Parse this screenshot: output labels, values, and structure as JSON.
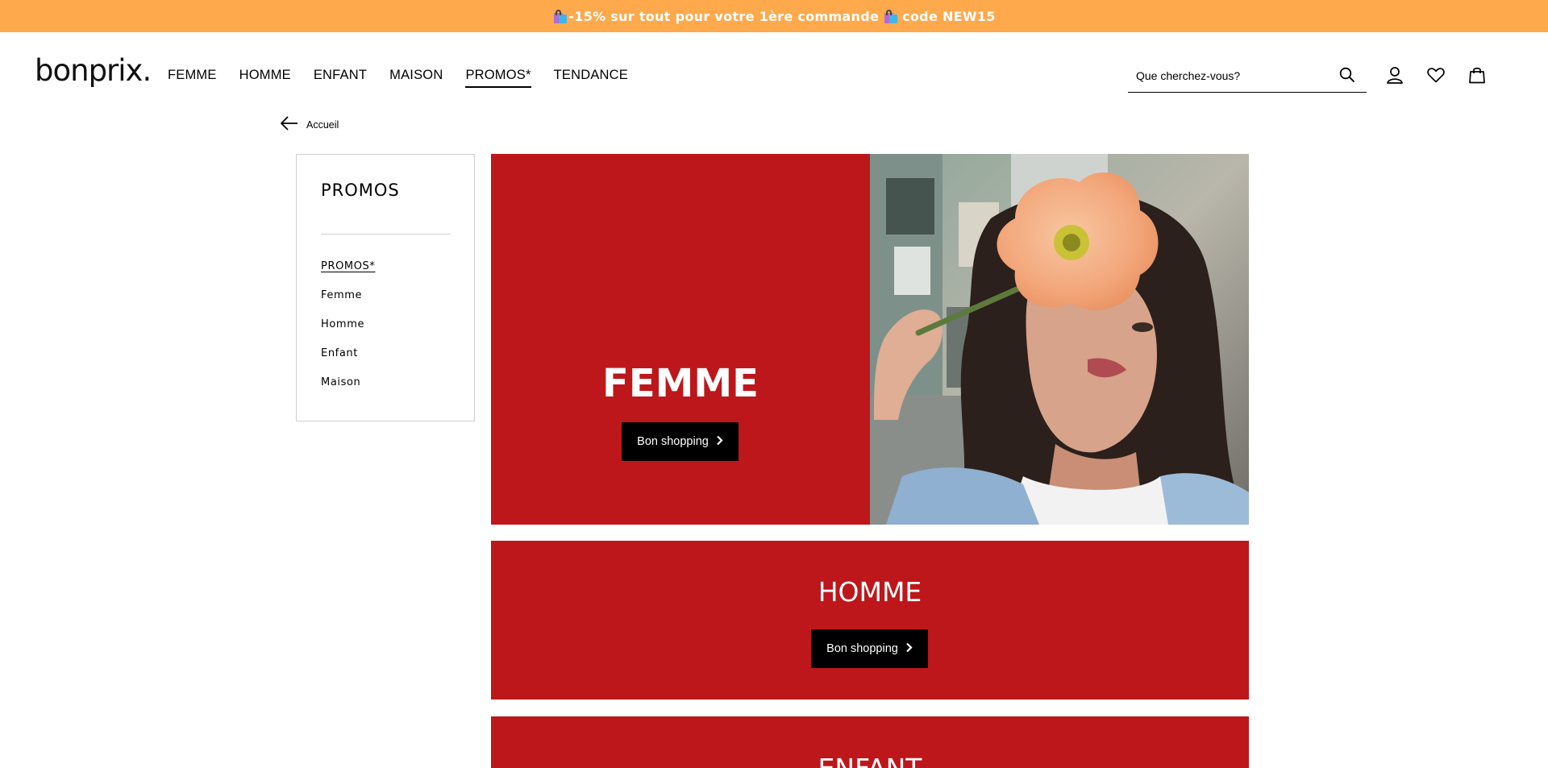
{
  "promo_bar": {
    "text_before": "-15% sur tout pour votre 1ère commande",
    "text_after": "code NEW15",
    "background": "#ffa94d",
    "icon": "shopping-bags-emoji"
  },
  "header": {
    "logo": "bonprix.",
    "nav": [
      "FEMME",
      "HOMME",
      "ENFANT",
      "MAISON",
      "PROMOS*",
      "TENDANCE"
    ],
    "active_nav": "PROMOS*",
    "search_placeholder": "Que cherchez-vous?",
    "icons": [
      "search-icon",
      "account-icon",
      "wishlist-heart-icon",
      "cart-bag-icon"
    ]
  },
  "breadcrumb": {
    "back_label": "Accueil",
    "icon": "arrow-left-icon"
  },
  "sidebar": {
    "title": "PROMOS",
    "items": [
      "PROMOS*",
      "Femme",
      "Homme",
      "Enfant",
      "Maison"
    ],
    "active_item": "PROMOS*"
  },
  "tiles": [
    {
      "title": "FEMME",
      "button_label": "Bon shopping"
    },
    {
      "title": "HOMME",
      "button_label": "Bon shopping"
    },
    {
      "title": "ENFANT"
    }
  ],
  "colors": {
    "tile_red": "#bd171b",
    "button_black": "#000000",
    "accent_orange": "#ffa94d"
  }
}
